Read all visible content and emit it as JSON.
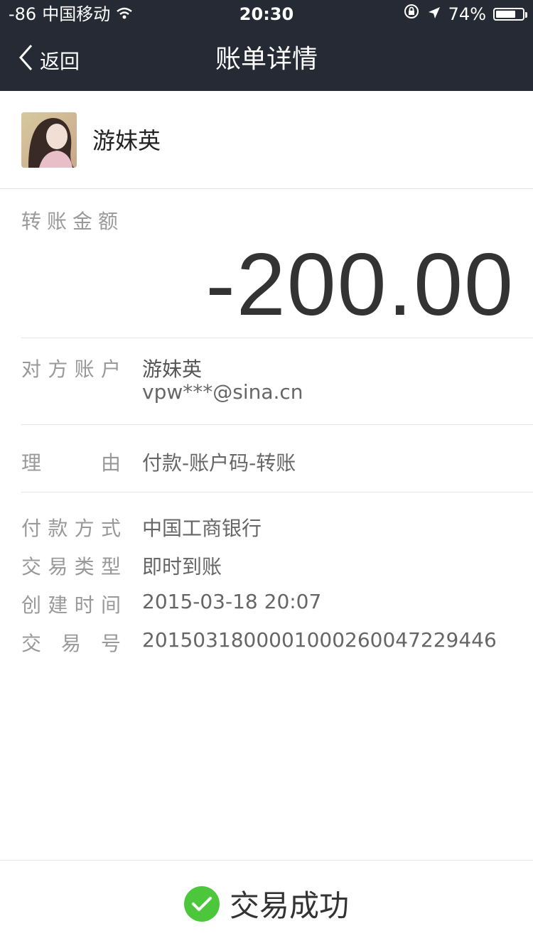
{
  "status_bar": {
    "signal": "-86",
    "carrier": "中国移动",
    "time": "20:30",
    "battery_text": "74%",
    "battery_level": 0.74
  },
  "nav": {
    "back_label": "返回",
    "title": "账单详情"
  },
  "contact": {
    "name": "游妹英"
  },
  "amount": {
    "label": "转账金额",
    "value": "-200.00"
  },
  "details": {
    "counterparty": {
      "label_chars": [
        "对",
        "方",
        "账",
        "户"
      ],
      "name": "游妹英",
      "account": "vpw***@sina.cn"
    },
    "reason": {
      "label_chars": [
        "理",
        "由"
      ],
      "value": "付款-账户码-转账"
    },
    "payment_method": {
      "label_chars": [
        "付",
        "款",
        "方",
        "式"
      ],
      "value": "中国工商银行"
    },
    "transaction_type": {
      "label_chars": [
        "交",
        "易",
        "类",
        "型"
      ],
      "value": "即时到账"
    },
    "created_time": {
      "label_chars": [
        "创",
        "建",
        "时",
        "间"
      ],
      "value": "2015-03-18 20:07"
    },
    "transaction_no": {
      "label_chars": [
        "交",
        "易",
        "号"
      ],
      "value": "2015031800001000260047229446"
    }
  },
  "footer": {
    "status": "交易成功",
    "icon": "check-circle-icon",
    "icon_color": "#4cc73c"
  },
  "colors": {
    "topbar": "#262a35"
  }
}
